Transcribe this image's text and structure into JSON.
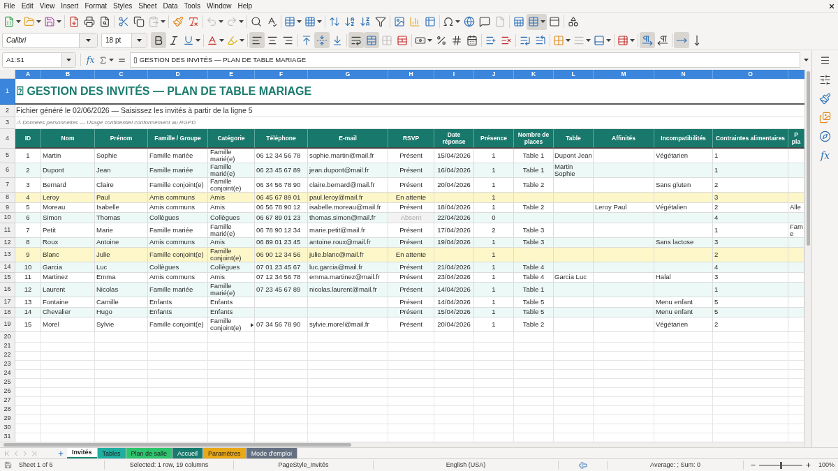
{
  "menu_bar": {
    "items": [
      "File",
      "Edit",
      "View",
      "Insert",
      "Format",
      "Styles",
      "Sheet",
      "Data",
      "Tools",
      "Window",
      "Help"
    ]
  },
  "standard_toolbar": [
    [
      {
        "kind": "new",
        "menu": true,
        "pressed": false,
        "disabled": false
      },
      {
        "kind": "open",
        "menu": true,
        "pressed": false,
        "disabled": false
      },
      {
        "kind": "save",
        "menu": true,
        "pressed": false,
        "disabled": false
      }
    ],
    [
      {
        "kind": "export_pdf",
        "pressed": false,
        "disabled": false
      },
      {
        "kind": "print",
        "pressed": false,
        "disabled": false
      },
      {
        "kind": "print_preview",
        "pressed": false,
        "disabled": false
      }
    ],
    [
      {
        "kind": "cut",
        "pressed": false,
        "disabled": false
      },
      {
        "kind": "copy",
        "pressed": false,
        "disabled": false
      },
      {
        "kind": "paste",
        "menu": true,
        "pressed": false,
        "disabled": true
      }
    ],
    [
      {
        "kind": "clone_format",
        "pressed": false,
        "disabled": false
      },
      {
        "kind": "clear_format",
        "pressed": false,
        "disabled": false
      }
    ],
    [
      {
        "kind": "undo",
        "menu": true,
        "pressed": false,
        "disabled": true
      },
      {
        "kind": "redo",
        "menu": true,
        "pressed": false,
        "disabled": true
      }
    ],
    [
      {
        "kind": "find_replace",
        "pressed": false,
        "disabled": false
      },
      {
        "kind": "spelling",
        "pressed": false,
        "disabled": false
      }
    ],
    [
      {
        "kind": "rows",
        "menu": true,
        "pressed": false,
        "disabled": false
      },
      {
        "kind": "columns",
        "menu": true,
        "pressed": false,
        "disabled": false
      }
    ],
    [
      {
        "kind": "sort",
        "pressed": false,
        "disabled": false
      },
      {
        "kind": "sort_ascending",
        "pressed": false,
        "disabled": false
      },
      {
        "kind": "sort_descending",
        "pressed": false,
        "disabled": false
      },
      {
        "kind": "autofilter",
        "pressed": false,
        "disabled": false
      }
    ],
    [
      {
        "kind": "image",
        "pressed": false,
        "disabled": false
      },
      {
        "kind": "chart",
        "pressed": false,
        "disabled": false
      },
      {
        "kind": "pivot_table",
        "pressed": false,
        "disabled": false
      }
    ],
    [
      {
        "kind": "special_character",
        "menu": true,
        "pressed": false,
        "disabled": false
      },
      {
        "kind": "hyperlink",
        "pressed": false,
        "disabled": false
      },
      {
        "kind": "comment",
        "pressed": false,
        "disabled": false
      },
      {
        "kind": "headers_footers",
        "pressed": false,
        "disabled": true
      }
    ],
    [
      {
        "kind": "print_area",
        "pressed": false,
        "disabled": false
      },
      {
        "kind": "freeze",
        "menu": true,
        "pressed": true,
        "disabled": false
      },
      {
        "kind": "split_window",
        "pressed": false,
        "disabled": false
      }
    ],
    [
      {
        "kind": "shapes",
        "pressed": false,
        "disabled": false
      }
    ]
  ],
  "format_toolbar": {
    "font_name": "Calibri",
    "font_size": "18 pt",
    "groups": [
      [
        {
          "kind": "bold",
          "pressed": true,
          "disabled": false
        },
        {
          "kind": "italic",
          "pressed": false,
          "disabled": false
        },
        {
          "kind": "underline",
          "menu": true,
          "pressed": false,
          "disabled": false
        }
      ],
      [
        {
          "kind": "font_color",
          "menu": true,
          "pressed": false,
          "disabled": false
        },
        {
          "kind": "highlight",
          "menu": true,
          "pressed": false,
          "disabled": false
        }
      ],
      [
        {
          "kind": "align_left",
          "pressed": true,
          "disabled": false
        },
        {
          "kind": "align_center",
          "pressed": false,
          "disabled": false
        },
        {
          "kind": "align_right",
          "pressed": false,
          "disabled": false
        }
      ],
      [
        {
          "kind": "align_top",
          "pressed": false,
          "disabled": false
        },
        {
          "kind": "align_middle",
          "pressed": true,
          "disabled": false
        },
        {
          "kind": "align_bottom",
          "pressed": false,
          "disabled": false
        }
      ],
      [
        {
          "kind": "wrap_text",
          "pressed": true,
          "disabled": false
        },
        {
          "kind": "merge_center",
          "pressed": true,
          "disabled": false
        },
        {
          "kind": "merge_cells",
          "pressed": false,
          "disabled": true
        },
        {
          "kind": "unmerge_cells",
          "pressed": false,
          "disabled": false
        }
      ],
      [
        {
          "kind": "currency",
          "menu": true,
          "pressed": false,
          "disabled": false
        },
        {
          "kind": "percent",
          "pressed": false,
          "disabled": false
        },
        {
          "kind": "number",
          "pressed": false,
          "disabled": false
        },
        {
          "kind": "date",
          "pressed": false,
          "disabled": false
        }
      ],
      [
        {
          "kind": "add_decimal",
          "pressed": false,
          "disabled": false
        },
        {
          "kind": "delete_decimal",
          "pressed": false,
          "disabled": false
        }
      ],
      [
        {
          "kind": "indent_more",
          "pressed": false,
          "disabled": false
        },
        {
          "kind": "indent_less",
          "pressed": false,
          "disabled": false
        }
      ],
      [
        {
          "kind": "borders",
          "menu": true,
          "pressed": false,
          "disabled": false
        },
        {
          "kind": "border_style",
          "menu": true,
          "pressed": false,
          "disabled": true
        },
        {
          "kind": "border_color",
          "menu": true,
          "pressed": false,
          "disabled": false
        }
      ],
      [
        {
          "kind": "conditional",
          "menu": true,
          "pressed": false,
          "disabled": false
        }
      ],
      [
        {
          "kind": "left_to_right",
          "pressed": true,
          "disabled": false
        },
        {
          "kind": "right_to_left",
          "pressed": false,
          "disabled": false
        }
      ],
      [
        {
          "kind": "text_horizontal",
          "pressed": true,
          "disabled": false
        },
        {
          "kind": "text_vertical",
          "pressed": false,
          "disabled": false
        }
      ]
    ]
  },
  "formula_bar": {
    "name_box": "A1:S1",
    "function_label": "fx",
    "content": "▯ GESTION DES INVITÉS — PLAN DE TABLE MARIAGE"
  },
  "sheet": {
    "columns": [
      {
        "letter": "A",
        "selected": true
      },
      {
        "letter": "B",
        "selected": true
      },
      {
        "letter": "C",
        "selected": true
      },
      {
        "letter": "D",
        "selected": true
      },
      {
        "letter": "E",
        "selected": true
      },
      {
        "letter": "F",
        "selected": true
      },
      {
        "letter": "G",
        "selected": true
      },
      {
        "letter": "H",
        "selected": true
      },
      {
        "letter": "I",
        "selected": true
      },
      {
        "letter": "J",
        "selected": true
      },
      {
        "letter": "K",
        "selected": true
      },
      {
        "letter": "L",
        "selected": true
      },
      {
        "letter": "M",
        "selected": true
      },
      {
        "letter": "N",
        "selected": true
      },
      {
        "letter": "O",
        "selected": true
      }
    ],
    "title_row": {
      "number": "1",
      "selected": true,
      "text": "⍰ GESTION DES INVITÉS — PLAN DE TABLE MARIAGE"
    },
    "note_rows": [
      {
        "number": "2",
        "kind": "info",
        "text": "Fichier généré le 02/06/2026 — Saisissez les invités à partir de la ligne 5"
      },
      {
        "number": "3",
        "kind": "notice",
        "text": "⚠ Données personnelles — Usage confidentiel conformément au RGPD"
      }
    ],
    "header_row": {
      "number": "4",
      "cells": [
        "ID",
        "Nom",
        "Prénom",
        "Famille / Groupe",
        "Catégorie",
        "Téléphone",
        "E-mail",
        "RSVP",
        "Date réponse",
        "Présence",
        "Nombre de places",
        "Table",
        "Affinités",
        "Incompatibilités",
        "Contraintes alimentaires",
        "P pla"
      ]
    },
    "guest_rows": [
      {
        "number": "5",
        "banded": false,
        "pending": false,
        "absent": false,
        "cells": [
          "1",
          "Martin",
          "Sophie",
          "Famille mariée",
          "Famille marié(e)",
          "06 12 34 56 78",
          "sophie.martin@mail.fr",
          "Présent",
          "15/04/2026",
          "1",
          "Table 1",
          "Dupont Jean",
          null,
          "Végétarien",
          "1",
          null
        ]
      },
      {
        "number": "6",
        "banded": true,
        "pending": false,
        "absent": false,
        "cells": [
          "2",
          "Dupont",
          "Jean",
          "Famille mariée",
          "Famille marié(e)",
          "06 23 45 67 89",
          "jean.dupont@mail.fr",
          "Présent",
          "16/04/2026",
          "1",
          "Table 1",
          "Martin Sophie",
          null,
          null,
          "1",
          null
        ]
      },
      {
        "number": "7",
        "banded": false,
        "pending": false,
        "absent": false,
        "cells": [
          "3",
          "Bernard",
          "Claire",
          "Famille conjoint(e)",
          "Famille conjoint(e)",
          "06 34 56 78 90",
          "claire.bernard@mail.fr",
          "Présent",
          "20/04/2026",
          "1",
          "Table 2",
          null,
          null,
          "Sans gluten",
          "2",
          null
        ]
      },
      {
        "number": "8",
        "pending": true,
        "absent": false,
        "cells": [
          "4",
          "Leroy",
          "Paul",
          "Amis communs",
          "Amis",
          "06 45 67 89 01",
          "paul.leroy@mail.fr",
          "En attente",
          null,
          "1",
          null,
          null,
          null,
          null,
          "3",
          null
        ]
      },
      {
        "number": "9",
        "banded": false,
        "pending": false,
        "absent": false,
        "cells": [
          "5",
          "Moreau",
          "Isabelle",
          "Amis communs",
          "Amis",
          "06 56 78 90 12",
          "isabelle.moreau@mail.fr",
          "Présent",
          "18/04/2026",
          "1",
          "Table 2",
          null,
          "Leroy Paul",
          "Végétalien",
          "2",
          "Alle"
        ]
      },
      {
        "number": "10",
        "banded": true,
        "pending": false,
        "absent": true,
        "cells": [
          "6",
          "Simon",
          "Thomas",
          "Collègues",
          "Collègues",
          "06 67 89 01 23",
          "thomas.simon@mail.fr",
          "Absent",
          "22/04/2026",
          "0",
          null,
          null,
          null,
          null,
          "4",
          null
        ]
      },
      {
        "number": "11",
        "banded": false,
        "pending": false,
        "absent": false,
        "cells": [
          "7",
          "Petit",
          "Marie",
          "Famille mariée",
          "Famille marié(e)",
          "06 78 90 12 34",
          "marie.petit@mail.fr",
          "Présent",
          "17/04/2026",
          "2",
          "Table 3",
          null,
          null,
          null,
          "1",
          "Fam e"
        ]
      },
      {
        "number": "12",
        "banded": true,
        "pending": false,
        "absent": false,
        "cells": [
          "8",
          "Roux",
          "Antoine",
          "Amis communs",
          "Amis",
          "06 89 01 23 45",
          "antoine.roux@mail.fr",
          "Présent",
          "19/04/2026",
          "1",
          "Table 3",
          null,
          null,
          "Sans lactose",
          "3",
          null
        ]
      },
      {
        "number": "13",
        "pending": true,
        "absent": false,
        "cells": [
          "9",
          "Blanc",
          "Julie",
          "Famille conjoint(e)",
          "Famille conjoint(e)",
          "06 90 12 34 56",
          "julie.blanc@mail.fr",
          "En attente",
          null,
          "1",
          null,
          null,
          null,
          null,
          "2",
          null
        ]
      },
      {
        "number": "14",
        "banded": true,
        "pending": false,
        "absent": false,
        "cells": [
          "10",
          "Garcia",
          "Luc",
          "Collègues",
          "Collègues",
          "07 01 23 45 67",
          "luc.garcia@mail.fr",
          "Présent",
          "21/04/2026",
          "1",
          "Table 4",
          null,
          null,
          null,
          "4",
          null
        ]
      },
      {
        "number": "15",
        "banded": false,
        "pending": false,
        "absent": false,
        "cells": [
          "11",
          "Martinez",
          "Emma",
          "Amis communs",
          "Amis",
          "07 12 34 56 78",
          "emma.martinez@mail.fr",
          "Présent",
          "23/04/2026",
          "1",
          "Table 4",
          "Garcia Luc",
          null,
          "Halal",
          "3",
          null
        ]
      },
      {
        "number": "16",
        "banded": true,
        "pending": false,
        "absent": false,
        "cells": [
          "12",
          "Laurent",
          "Nicolas",
          "Famille mariée",
          "Famille marié(e)",
          "07 23 45 67 89",
          "nicolas.laurent@mail.fr",
          "Présent",
          "14/04/2026",
          "1",
          "Table 1",
          null,
          null,
          null,
          "1",
          null
        ]
      },
      {
        "number": "17",
        "banded": false,
        "pending": false,
        "absent": false,
        "cells": [
          "13",
          "Fontaine",
          "Camille",
          "Enfants",
          "Enfants",
          null,
          null,
          "Présent",
          "14/04/2026",
          "1",
          "Table 5",
          null,
          null,
          "Menu enfant",
          "5",
          null
        ]
      },
      {
        "number": "18",
        "banded": true,
        "pending": false,
        "absent": false,
        "cells": [
          "14",
          "Chevalier",
          "Hugo",
          "Enfants",
          "Enfants",
          null,
          null,
          "Présent",
          "15/04/2026",
          "1",
          "Table 5",
          null,
          null,
          "Menu enfant",
          "5",
          null
        ]
      },
      {
        "number": "19",
        "banded": false,
        "pending": false,
        "absent": false,
        "overflow_mark": true,
        "cells": [
          "15",
          "Morel",
          "Sylvie",
          "Famille conjoint(e)",
          "Famille conjoint(e)",
          "07 34 56 78 90",
          "sylvie.morel@mail.fr",
          "Présent",
          "20/04/2026",
          "1",
          "Table 2",
          null,
          null,
          "Végétarien",
          "2",
          null
        ]
      }
    ],
    "empty_rows": [
      "20",
      "21",
      "22",
      "23",
      "24",
      "25",
      "26",
      "27",
      "28",
      "29",
      "30",
      "31"
    ]
  },
  "sidebar": {
    "items": [
      {
        "kind": "properties"
      },
      {
        "kind": "styles"
      },
      {
        "kind": "gallery"
      },
      {
        "kind": "navigator"
      },
      {
        "kind": "functions",
        "label": "fx"
      }
    ]
  },
  "sheet_tabs": [
    {
      "label": "Invités",
      "selected": true,
      "color": "#1a8a7a"
    },
    {
      "label": "Tables",
      "selected": false,
      "color": "#1fae9f"
    },
    {
      "label": "Plan de salle",
      "selected": false,
      "color": "#2ec46e"
    },
    {
      "label": "Accueil",
      "selected": false,
      "color": "#177a6d"
    },
    {
      "label": "Paramètres",
      "selected": false,
      "color": "#e8a817"
    },
    {
      "label": "Mode d'emploi",
      "selected": false,
      "color": "#647080"
    }
  ],
  "status_bar": {
    "sheet": "Sheet 1 of 6",
    "selection": "Selected: 1 row, 19 columns",
    "page_style": "PageStyle_Invités",
    "language": "English (USA)",
    "sum": "Average: ; Sum: 0",
    "zoom": {
      "level": 0.5,
      "reading": "100%"
    }
  }
}
